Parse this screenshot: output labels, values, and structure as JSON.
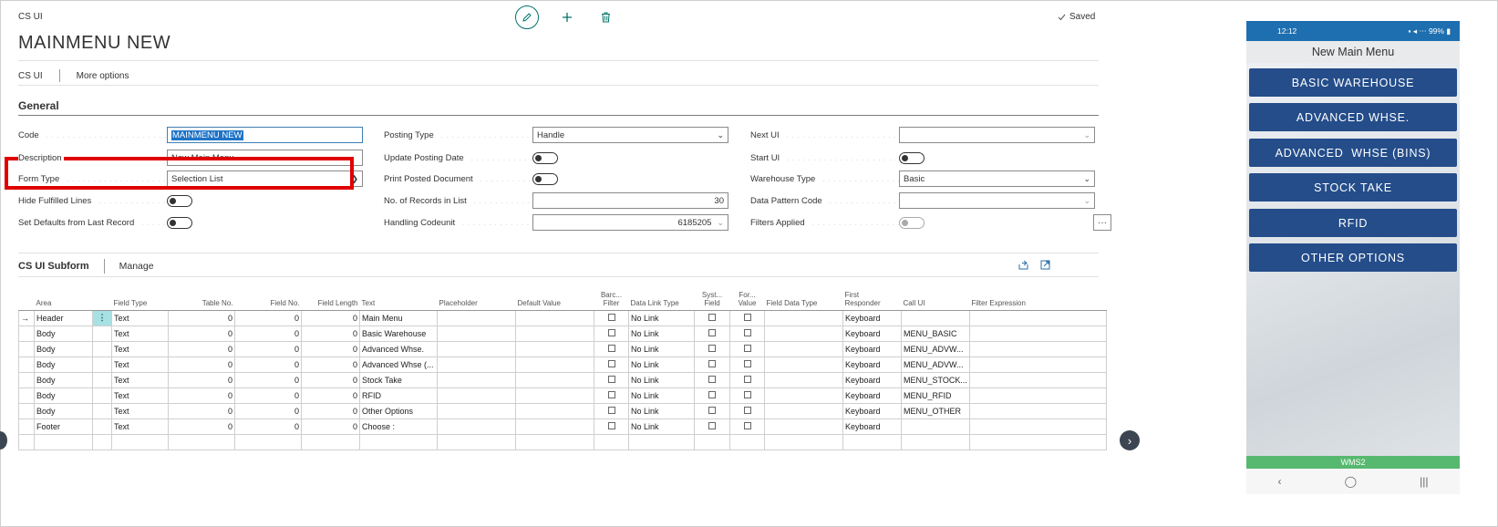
{
  "app": {
    "breadcrumb": "CS UI",
    "title": "MAINMENU NEW",
    "saved_label": "Saved",
    "icons": {
      "edit": "pencil-icon",
      "new": "plus-icon",
      "delete": "trash-icon",
      "saved": "check-icon"
    }
  },
  "actionbar": {
    "item1": "CS UI",
    "item2": "More options"
  },
  "general": {
    "section_title": "General",
    "col1": {
      "code_label": "Code",
      "code_value": "MAINMENU NEW",
      "description_label": "Description",
      "description_value": "New Main Menu",
      "form_type_label": "Form Type",
      "form_type_value": "Selection List",
      "hide_fulfilled_label": "Hide Fulfilled Lines",
      "set_defaults_label": "Set Defaults from Last Record"
    },
    "col2": {
      "posting_type_label": "Posting Type",
      "posting_type_value": "Handle",
      "update_posting_date_label": "Update Posting Date",
      "print_posted_label": "Print Posted Document",
      "records_label": "No. of Records in List",
      "records_value": "30",
      "codeunit_label": "Handling Codeunit",
      "codeunit_value": "6185205"
    },
    "col3": {
      "next_ui_label": "Next UI",
      "next_ui_value": "",
      "start_ui_label": "Start UI",
      "warehouse_type_label": "Warehouse Type",
      "warehouse_type_value": "Basic",
      "data_pattern_label": "Data Pattern Code",
      "data_pattern_value": "",
      "filters_label": "Filters Applied",
      "filters_button": "···"
    }
  },
  "subform": {
    "title": "CS UI Subform",
    "manage": "Manage",
    "headers": {
      "area": "Area",
      "field_type": "Field Type",
      "table_no": "Table No.",
      "field_no": "Field No.",
      "field_length": "Field Length",
      "text": "Text",
      "placeholder": "Placeholder",
      "default_value": "Default Value",
      "barc_1": "Barc...",
      "barc_2": "Filter",
      "data_link_type": "Data Link Type",
      "syst_1": "Syst...",
      "syst_2": "Field",
      "for_1": "For...",
      "for_2": "Value",
      "field_data_type": "Field Data Type",
      "first_1": "First",
      "first_2": "Responder",
      "call_ui": "Call UI",
      "filter_expression": "Filter Expression"
    },
    "rows": [
      {
        "marker": "→",
        "area": "Header",
        "field_type": "Text",
        "table_no": "0",
        "field_no": "0",
        "field_length": "0",
        "text": "Main Menu",
        "data_link": "No Link",
        "responder": "Keyboard",
        "call_ui": ""
      },
      {
        "marker": "",
        "area": "Body",
        "field_type": "Text",
        "table_no": "0",
        "field_no": "0",
        "field_length": "0",
        "text": "Basic Warehouse",
        "data_link": "No Link",
        "responder": "Keyboard",
        "call_ui": "MENU_BASIC"
      },
      {
        "marker": "",
        "area": "Body",
        "field_type": "Text",
        "table_no": "0",
        "field_no": "0",
        "field_length": "0",
        "text": "Advanced Whse.",
        "data_link": "No Link",
        "responder": "Keyboard",
        "call_ui": "MENU_ADVW..."
      },
      {
        "marker": "",
        "area": "Body",
        "field_type": "Text",
        "table_no": "0",
        "field_no": "0",
        "field_length": "0",
        "text": "Advanced  Whse (...",
        "data_link": "No Link",
        "responder": "Keyboard",
        "call_ui": "MENU_ADVW..."
      },
      {
        "marker": "",
        "area": "Body",
        "field_type": "Text",
        "table_no": "0",
        "field_no": "0",
        "field_length": "0",
        "text": "Stock Take",
        "data_link": "No Link",
        "responder": "Keyboard",
        "call_ui": "MENU_STOCK..."
      },
      {
        "marker": "",
        "area": "Body",
        "field_type": "Text",
        "table_no": "0",
        "field_no": "0",
        "field_length": "0",
        "text": "RFID",
        "data_link": "No Link",
        "responder": "Keyboard",
        "call_ui": "MENU_RFID"
      },
      {
        "marker": "",
        "area": "Body",
        "field_type": "Text",
        "table_no": "0",
        "field_no": "0",
        "field_length": "0",
        "text": "Other Options",
        "data_link": "No Link",
        "responder": "Keyboard",
        "call_ui": "MENU_OTHER"
      },
      {
        "marker": "",
        "area": "Footer",
        "field_type": "Text",
        "table_no": "0",
        "field_no": "0",
        "field_length": "0",
        "text": "Choose :",
        "data_link": "No Link",
        "responder": "Keyboard",
        "call_ui": ""
      }
    ]
  },
  "phone": {
    "time": "12:12",
    "status_right": "99%",
    "title": "New Main Menu",
    "buttons": [
      "BASIC WAREHOUSE",
      "ADVANCED WHSE.",
      "ADVANCED  WHSE (BINS)",
      "STOCK TAKE",
      "RFID",
      "OTHER OPTIONS"
    ],
    "footer": "WMS2",
    "nav": [
      "‹",
      "◯",
      "|||"
    ]
  },
  "colors": {
    "accent": "#00756b",
    "phone_button": "#244d8a",
    "phone_status": "#1e6fb0",
    "phone_footer": "#57b86f",
    "highlight": "#e00000"
  }
}
